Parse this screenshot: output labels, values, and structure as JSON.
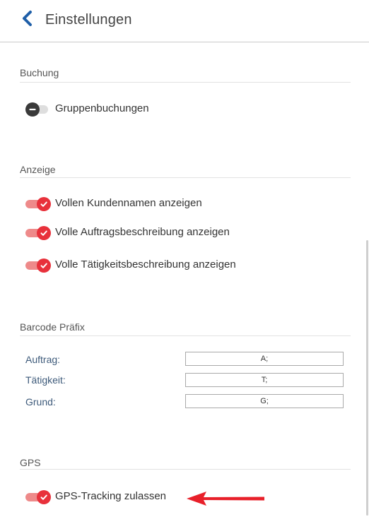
{
  "header": {
    "title": "Einstellungen"
  },
  "sections": {
    "buchung": {
      "title": "Buchung",
      "toggles": [
        {
          "label": "Gruppenbuchungen",
          "state": "off"
        }
      ]
    },
    "anzeige": {
      "title": "Anzeige",
      "toggles": [
        {
          "label": "Vollen Kundennamen anzeigen",
          "state": "on"
        },
        {
          "label": "Volle Auftragsbeschreibung anzeigen",
          "state": "on"
        },
        {
          "label": "Volle Tätigkeitsbeschreibung anzeigen",
          "state": "on"
        }
      ]
    },
    "barcode": {
      "title": "Barcode Präfix",
      "fields": [
        {
          "label": "Auftrag:",
          "value": "A;"
        },
        {
          "label": "Tätigkeit:",
          "value": "T;"
        },
        {
          "label": "Grund:",
          "value": "G;"
        }
      ]
    },
    "gps": {
      "title": "GPS",
      "toggles": [
        {
          "label": "GPS-Tracking zulassen",
          "state": "on"
        }
      ]
    }
  },
  "colors": {
    "accent_on": "#e8313b",
    "track_on": "#ee8a8a",
    "knob_off": "#3a3a3a",
    "back_icon": "#1f5fa8",
    "annotation_arrow": "#e8202a"
  },
  "icons": {
    "back": "chevron-left-icon",
    "toggle_on": "checkmark-icon",
    "toggle_off": "minus-icon",
    "annotation": "arrow-left-icon"
  }
}
